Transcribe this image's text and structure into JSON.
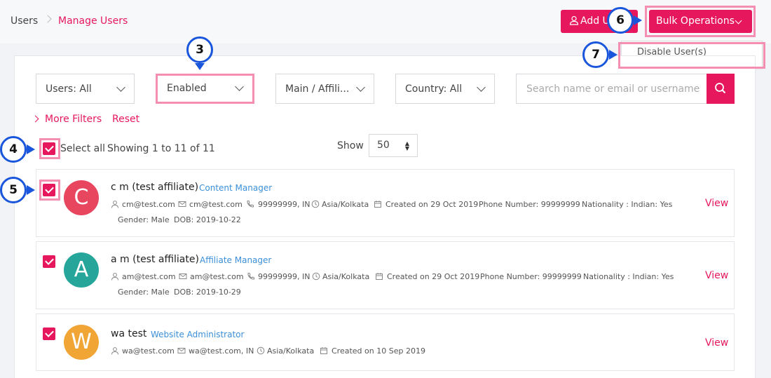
{
  "breadcrumb": {
    "root": "Users",
    "current": "Manage Users"
  },
  "header": {
    "add_user_label": "Add U",
    "bulk_label": "Bulk Operations"
  },
  "bulk_menu": {
    "items": [
      "Disable User(s)"
    ]
  },
  "filters": {
    "users": "Users: All",
    "status": "Enabled",
    "type": "Main / Affili...",
    "country": "Country: All",
    "search_placeholder": "Search name or email or username"
  },
  "links": {
    "more_filters": "More Filters",
    "reset": "Reset"
  },
  "list_controls": {
    "select_all": "Select all",
    "showing": "Showing 1 to 11 of 11",
    "show_label": "Show",
    "show_value": "50"
  },
  "users": [
    {
      "initial": "C",
      "name": "c m (test affiliate)",
      "role": "Content Manager",
      "username": "cm@test.com",
      "email": "cm@test.com",
      "phone": "99999999, IN",
      "timezone": "Asia/Kolkata",
      "created": "Created on 29 Oct 2019",
      "phone_number": "Phone Number: 99999999",
      "nationality": "Nationality : Indian: Yes",
      "gender": "Gender: Male",
      "dob": "DOB: 2019-10-22",
      "view": "View",
      "avatar_color": "#e8455f"
    },
    {
      "initial": "A",
      "name": "a m (test affiliate)",
      "role": "Affiliate Manager",
      "username": "am@test.com",
      "email": "am@test.com",
      "phone": "99999999, IN",
      "timezone": "Asia/Kolkata",
      "created": "Created on 29 Oct 2019",
      "phone_number": "Phone Number: 99999999",
      "nationality": "Nationality : Indian: Yes",
      "gender": "Gender: Male",
      "dob": "DOB: 2019-10-29",
      "view": "View",
      "avatar_color": "#26a69a"
    },
    {
      "initial": "W",
      "name": "wa test",
      "role": "Website Administrator",
      "username": "wa@test.com",
      "email": "wa@test.com, IN",
      "timezone": "Asia/Kolkata",
      "created": "Created on 10 Sep 2019",
      "view": "View",
      "avatar_color": "#f0a535"
    }
  ],
  "annotations": [
    "3",
    "4",
    "5",
    "6",
    "7"
  ],
  "colors": {
    "accent": "#e6175c",
    "highlight": "#f48fb1",
    "marker": "#1a56db",
    "role_link": "#3b8fd8"
  },
  "icons": [
    "chevron-right-icon",
    "user-icon",
    "chevron-down-icon",
    "search-icon",
    "check-icon",
    "envelope-icon",
    "phone-icon",
    "clock-icon",
    "calendar-icon"
  ]
}
